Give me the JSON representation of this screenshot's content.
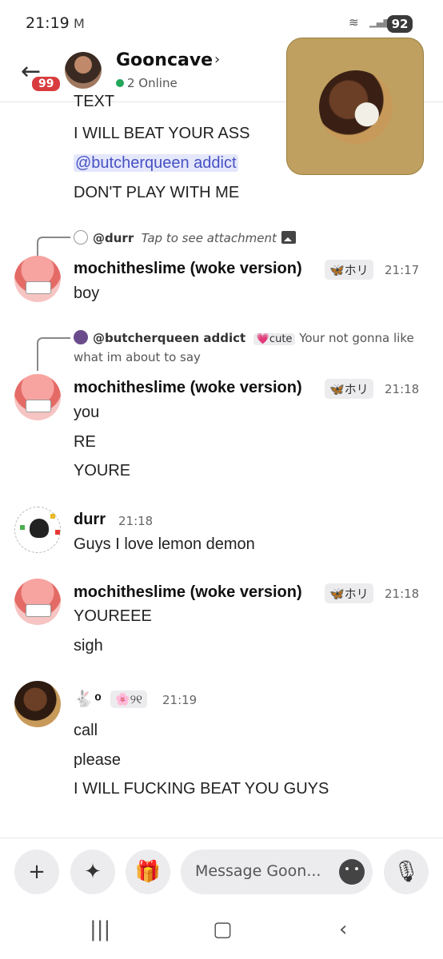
{
  "status": {
    "time": "21:19",
    "mail_icon": "gmail-icon",
    "battery": "92"
  },
  "header": {
    "unread": "99",
    "channel": "Gooncave",
    "online": "2 Online"
  },
  "messages": {
    "top_lines": [
      "TEXT",
      "I WILL BEAT YOUR ASS",
      "@butcherqueen addict",
      "DON'T PLAY WITH ME"
    ],
    "m1": {
      "reply_user": "@durr",
      "reply_text": "Tap to see attachment",
      "author": "mochitheslime (woke version)",
      "tag": "🦋ホリ",
      "time": "21:17",
      "lines": [
        "boy"
      ]
    },
    "m2": {
      "reply_user": "@butcherqueen addict",
      "reply_tag": "💗cute",
      "reply_text": "Your not gonna like",
      "reply_text2": "what im about to say",
      "author": "mochitheslime (woke version)",
      "tag": "🦋ホリ",
      "time": "21:18",
      "lines": [
        "you",
        "RE",
        "YOURE"
      ]
    },
    "m3": {
      "author": "durr",
      "time": "21:18",
      "lines": [
        "Guys I love lemon demon"
      ]
    },
    "m4": {
      "author": "mochitheslime (woke version)",
      "tag": "🦋ホリ",
      "time": "21:18",
      "lines": [
        "YOUREEE",
        "sigh"
      ]
    },
    "m5": {
      "author": "🐇 ͦ",
      "tag": "🌸୨୧",
      "time": "21:19",
      "lines": [
        "call",
        "please",
        "I WILL FUCKING BEAT YOU GUYS"
      ]
    }
  },
  "input": {
    "placeholder": "Message Goon..."
  }
}
